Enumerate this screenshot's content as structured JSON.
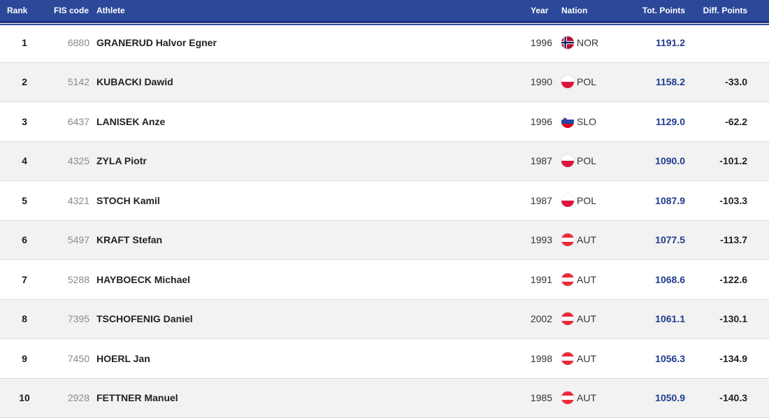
{
  "headers": {
    "rank": "Rank",
    "fis": "FIS code",
    "athlete": "Athlete",
    "year": "Year",
    "nation": "Nation",
    "tot": "Tot. Points",
    "diff": "Diff. Points"
  },
  "rows": [
    {
      "rank": "1",
      "fis": "6880",
      "athlete": "GRANERUD Halvor Egner",
      "year": "1996",
      "nation": "NOR",
      "flag": "NOR",
      "tot": "1191.2",
      "diff": ""
    },
    {
      "rank": "2",
      "fis": "5142",
      "athlete": "KUBACKI Dawid",
      "year": "1990",
      "nation": "POL",
      "flag": "POL",
      "tot": "1158.2",
      "diff": "-33.0"
    },
    {
      "rank": "3",
      "fis": "6437",
      "athlete": "LANISEK Anze",
      "year": "1996",
      "nation": "SLO",
      "flag": "SLO",
      "tot": "1129.0",
      "diff": "-62.2"
    },
    {
      "rank": "4",
      "fis": "4325",
      "athlete": "ZYLA Piotr",
      "year": "1987",
      "nation": "POL",
      "flag": "POL",
      "tot": "1090.0",
      "diff": "-101.2"
    },
    {
      "rank": "5",
      "fis": "4321",
      "athlete": "STOCH Kamil",
      "year": "1987",
      "nation": "POL",
      "flag": "POL",
      "tot": "1087.9",
      "diff": "-103.3"
    },
    {
      "rank": "6",
      "fis": "5497",
      "athlete": "KRAFT Stefan",
      "year": "1993",
      "nation": "AUT",
      "flag": "AUT",
      "tot": "1077.5",
      "diff": "-113.7"
    },
    {
      "rank": "7",
      "fis": "5288",
      "athlete": "HAYBOECK Michael",
      "year": "1991",
      "nation": "AUT",
      "flag": "AUT",
      "tot": "1068.6",
      "diff": "-122.6"
    },
    {
      "rank": "8",
      "fis": "7395",
      "athlete": "TSCHOFENIG Daniel",
      "year": "2002",
      "nation": "AUT",
      "flag": "AUT",
      "tot": "1061.1",
      "diff": "-130.1"
    },
    {
      "rank": "9",
      "fis": "7450",
      "athlete": "HOERL Jan",
      "year": "1998",
      "nation": "AUT",
      "flag": "AUT",
      "tot": "1056.3",
      "diff": "-134.9"
    },
    {
      "rank": "10",
      "fis": "2928",
      "athlete": "FETTNER Manuel",
      "year": "1985",
      "nation": "AUT",
      "flag": "AUT",
      "tot": "1050.9",
      "diff": "-140.3"
    }
  ],
  "colors": {
    "header_bg": "#2b4899",
    "points_text": "#1f3c8f",
    "row_alt_bg": "#f2f2f2"
  }
}
